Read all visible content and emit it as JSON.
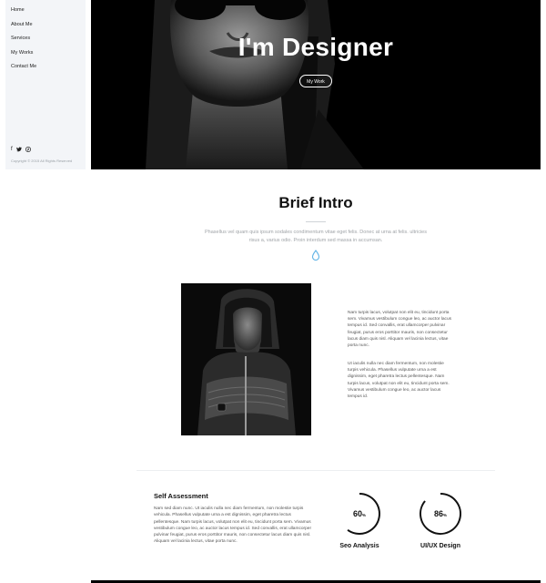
{
  "sidebar": {
    "items": [
      {
        "label": "Home"
      },
      {
        "label": "About Me"
      },
      {
        "label": "Services"
      },
      {
        "label": "My Works"
      },
      {
        "label": "Contact Me"
      }
    ],
    "social": [
      {
        "icon": "facebook-icon",
        "glyph": "f"
      },
      {
        "icon": "twitter-icon",
        "glyph": "🐦"
      },
      {
        "icon": "pinterest-icon",
        "glyph": "℗"
      }
    ],
    "copyright": "Copyright © 2015 All Rights Reserved"
  },
  "hero": {
    "title": "I'm Designer",
    "button_label": "My Work"
  },
  "intro": {
    "title": "Brief Intro",
    "text": "Phasellus vel quam quis ipsum sodales condimentum vitae eget felis. Donec at urna at felis. ultricies risus a, varius odio. Proin interdum sed massa in accumsan."
  },
  "about": {
    "paragraph1": "Nam turpis lacus, volutpat non elit eu, tincidunt porta sem. Vivamus vestibulum congue leo, ac auctor lacus tempus id. Sed convallis, erat ullamcorper pulvinar feugiat, purus eros porttitor mauris, non consectetur lacus diam quis nisl. Aliquam vel lacinia lectus, vitae porta nunc.",
    "paragraph2": "Ut iaculis nulla nec diam fermentum, non molestie turpis vehicula. Phasellus vulputate urna a est dignissim, eget pharetra lectus pellentesque. Nam turpis lacus, volutpat non elit eu, tincidunt porta sem. Vivamus vestibulum congue leo, ac auctor lacus tempus id."
  },
  "self": {
    "title": "Self Assessment",
    "text": "Nam sed diam nunc. Ut iaculis nulla nec diam fermentum, non molestie turpis vehicula. Phasellus vulputate urna a est dignissim, eget pharetra lectus pellentesque. Nam turpis lacus, volutpat non elit eu, tincidunt porta sem. Vivamus vestibulum congue leo, ac auctor lacus tempus id. Sed convallis, erat ullamcorper pulvinar feugiat, purus eros porttitor mauris, non consectetur lacus diam quis nisl. Aliquam vel lacinia lectus, vitae porta nunc."
  },
  "skills": [
    {
      "value": "60",
      "unit": "%",
      "label": "Seo Analysis",
      "fraction": 0.6
    },
    {
      "value": "86",
      "unit": "%",
      "label": "UI/UX Design",
      "fraction": 0.86
    }
  ],
  "colors": {
    "sidebar_bg": "#f3f5f8",
    "hero_bg": "#000000",
    "accent_drop": "#5fb3e6",
    "gauge_track": "#111111"
  }
}
